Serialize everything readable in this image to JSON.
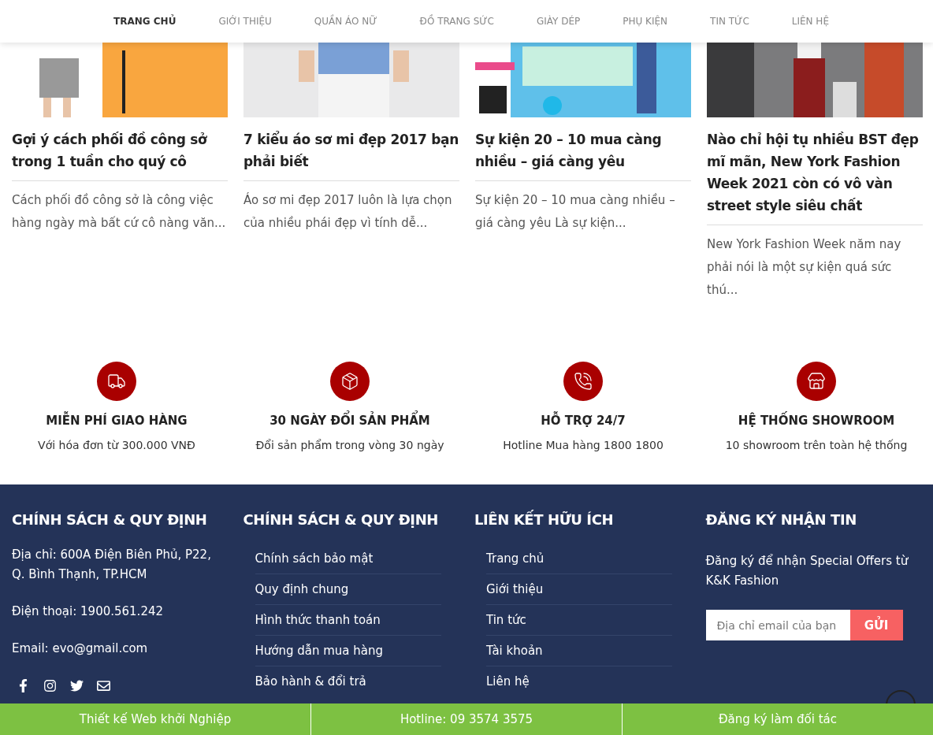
{
  "nav": [
    {
      "label": "TRANG CHỦ",
      "selected": true
    },
    {
      "label": "GIỚI THIỆU",
      "selected": false
    },
    {
      "label": "QUẦN ÁO NỮ",
      "selected": false
    },
    {
      "label": "ĐỒ TRANG SỨC",
      "selected": false
    },
    {
      "label": "GIÀY DÉP",
      "selected": false
    },
    {
      "label": "PHỤ KIỆN",
      "selected": false
    },
    {
      "label": "TIN TỨC",
      "selected": false
    },
    {
      "label": "LIÊN HỆ",
      "selected": false
    }
  ],
  "articles": [
    {
      "title": "Gợi ý cách phối đồ công sở trong 1 tuần cho quý cô",
      "excerpt": "Cách phối đồ công sở là công việc hàng ngày mà bất cứ cô nàng văn..."
    },
    {
      "title": "7 kiểu áo sơ mi đẹp 2017 bạn phải biết",
      "excerpt": "Áo sơ mi đẹp 2017 luôn là lựa chọn của nhiều phái đẹp vì tính dễ..."
    },
    {
      "title": "Sự kiện 20 – 10 mua càng nhiều – giá càng yêu",
      "excerpt": "Sự kiện 20 – 10 mua càng nhiều – giá càng yêu Là sự kiện..."
    },
    {
      "title": "Nào chỉ hội tụ nhiều BST đẹp mĩ mãn, New York Fashion Week 2021 còn có vô vàn street style siêu chất",
      "excerpt": "New York Fashion Week năm nay phải nói là một sự kiện quá sức thú..."
    }
  ],
  "features": [
    {
      "title": "MIỄN PHÍ GIAO HÀNG",
      "text": "Với hóa đơn từ 300.000 VNĐ"
    },
    {
      "title": "30 NGÀY ĐỔI SẢN PHẨM",
      "text": "Đổi sản phẩm trong vòng 30 ngày"
    },
    {
      "title": "HỖ TRỢ 24/7",
      "text": "Hotline Mua hàng 1800 1800"
    },
    {
      "title": "HỆ THỐNG SHOWROOM",
      "text": "10 showroom trên toàn hệ thống"
    }
  ],
  "footer": {
    "contact": {
      "heading": "CHÍNH SÁCH & QUY ĐỊNH",
      "lines": [
        "Địa chỉ: 600A Điện Biên Phủ, P22, Q. Bình Thạnh, TP.HCM",
        "Điện thoại: 1900.561.242",
        "Email: evo@gmail.com"
      ]
    },
    "policy": {
      "heading": "CHÍNH SÁCH & QUY ĐỊNH",
      "links": [
        "Chính sách bảo mật",
        "Quy định chung",
        "Hình thức thanh toán",
        "Hướng dẫn mua hàng",
        "Bảo hành & đổi trả"
      ]
    },
    "links": {
      "heading": "LIÊN KẾT HỮU ÍCH",
      "links": [
        "Trang chủ",
        "Giới thiệu",
        "Tin tức",
        "Tài khoản",
        "Liên hệ"
      ]
    },
    "newsletter": {
      "heading": "ĐĂNG KÝ NHẬN TIN",
      "text": "Đăng ký để nhận Special Offers từ K&K Fashion",
      "placeholder": "Địa chỉ email của bạn",
      "button": "GỬI"
    }
  },
  "bottom_bar": [
    "Thiết kế Web khởi Nghiệp",
    "Hotline: 09 3574 3575",
    "Đăng ký làm đối tác"
  ]
}
